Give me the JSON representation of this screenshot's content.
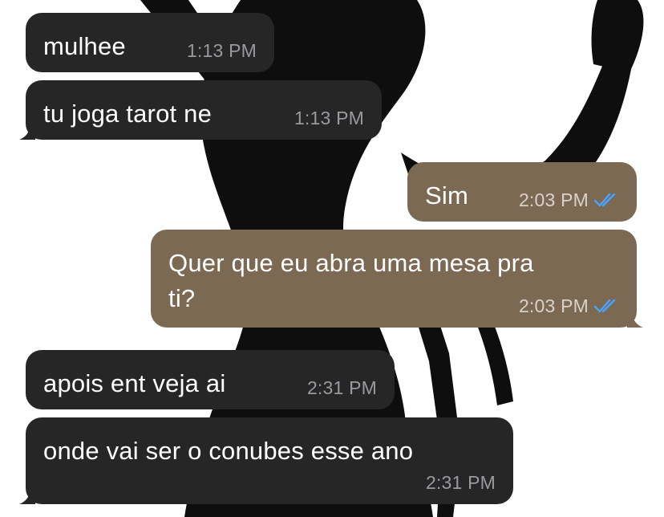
{
  "colors": {
    "incoming_bubble": "#262627",
    "outgoing_bubble": "#7c6953",
    "read_ticks": "#4aa3ff",
    "wallpaper_background": "#ffffff",
    "wallpaper_silhouette": "#0e0e0e"
  },
  "wallpaper": {
    "description_icon": "silhouette-image"
  },
  "messages": [
    {
      "direction": "incoming",
      "text": "mulhee",
      "time": "1:13 PM",
      "status": ""
    },
    {
      "direction": "incoming",
      "text": "tu joga tarot ne",
      "time": "1:13 PM",
      "status": ""
    },
    {
      "direction": "outgoing",
      "text": "Sim",
      "time": "2:03 PM",
      "status": "read"
    },
    {
      "direction": "outgoing",
      "text": "Quer que eu abra uma mesa pra\nti?",
      "time": "2:03 PM",
      "status": "read"
    },
    {
      "direction": "incoming",
      "text": "apois ent veja ai",
      "time": "2:31 PM",
      "status": ""
    },
    {
      "direction": "incoming",
      "text": "onde vai ser o conubes esse ano",
      "time": "2:31 PM",
      "status": ""
    }
  ]
}
